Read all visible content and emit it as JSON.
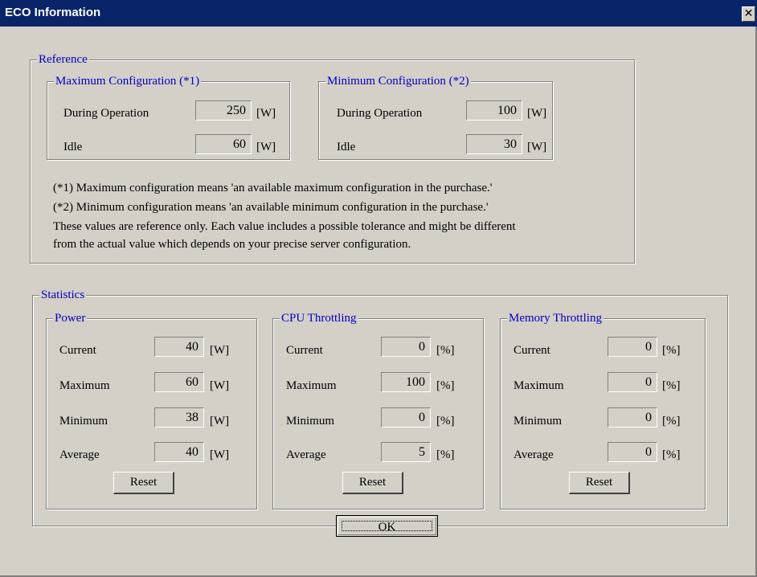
{
  "window": {
    "title": "ECO Information",
    "close_glyph": "✕"
  },
  "reference": {
    "legend": "Reference",
    "max_config": {
      "legend": "Maximum Configuration (*1)",
      "operation_label": "During Operation",
      "operation_value": "250",
      "idle_label": "Idle",
      "idle_value": "60",
      "unit": "[W]"
    },
    "min_config": {
      "legend": "Minimum Configuration (*2)",
      "operation_label": "During Operation",
      "operation_value": "100",
      "idle_label": "Idle",
      "idle_value": "30",
      "unit": "[W]"
    },
    "notes": [
      "(*1) Maximum configuration means 'an available maximum configuration in the purchase.'",
      "(*2) Minimum configuration means 'an available minimum configuration in the purchase.'",
      "These values are reference only. Each value includes a possible tolerance and might be different",
      "from the actual value which depends on your precise server configuration."
    ]
  },
  "statistics": {
    "legend": "Statistics",
    "power": {
      "legend": "Power",
      "unit": "[W]",
      "current_label": "Current",
      "current": "40",
      "maximum_label": "Maximum",
      "maximum": "60",
      "minimum_label": "Minimum",
      "minimum": "38",
      "average_label": "Average",
      "average": "40",
      "reset_label": "Reset"
    },
    "cpu": {
      "legend": "CPU Throttling",
      "unit": "[%]",
      "current_label": "Current",
      "current": "0",
      "maximum_label": "Maximum",
      "maximum": "100",
      "minimum_label": "Minimum",
      "minimum": "0",
      "average_label": "Average",
      "average": "5",
      "reset_label": "Reset"
    },
    "memory": {
      "legend": "Memory Throttling",
      "unit": "[%]",
      "current_label": "Current",
      "current": "0",
      "maximum_label": "Maximum",
      "maximum": "0",
      "minimum_label": "Minimum",
      "minimum": "0",
      "average_label": "Average",
      "average": "0",
      "reset_label": "Reset"
    }
  },
  "ok_label": "OK"
}
